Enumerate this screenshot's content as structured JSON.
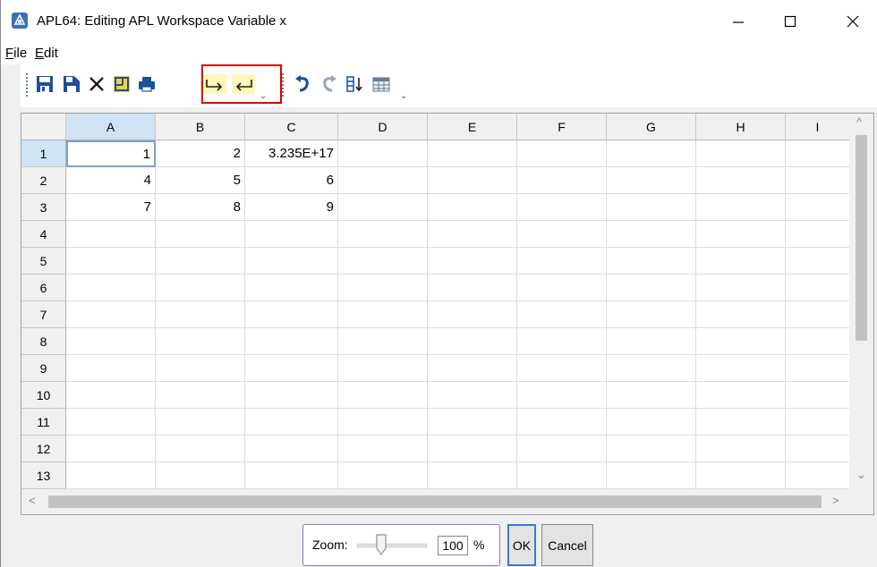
{
  "window": {
    "title": "APL64: Editing APL Workspace Variable x",
    "minimize_glyph": "—",
    "maximize_glyph": "☐",
    "close_glyph": "✕"
  },
  "menu": [
    {
      "label": "File",
      "accel": "F",
      "rest": "ile"
    },
    {
      "label": "Edit",
      "accel": "E",
      "rest": "dit"
    }
  ],
  "toolbar": {
    "icons": [
      "save-icon",
      "save-as-icon",
      "close-icon",
      "resize-icon",
      "print-icon",
      "redirect-right-icon",
      "redirect-left-icon",
      "undo-icon",
      "redo-icon",
      "sort-icon",
      "table-icon"
    ],
    "overflow_glyph": "⌄"
  },
  "grid": {
    "columns": [
      "A",
      "B",
      "C",
      "D",
      "E",
      "F",
      "G",
      "H",
      "I"
    ],
    "rows": [
      "1",
      "2",
      "3",
      "4",
      "5",
      "6",
      "7",
      "8",
      "9",
      "10",
      "11",
      "12",
      "13"
    ],
    "cells": [
      [
        "1",
        "2",
        "3.235E+17",
        "",
        "",
        "",
        "",
        "",
        ""
      ],
      [
        "4",
        "5",
        "6",
        "",
        "",
        "",
        "",
        "",
        ""
      ],
      [
        "7",
        "8",
        "9",
        "",
        "",
        "",
        "",
        "",
        ""
      ],
      [
        "",
        "",
        "",
        "",
        "",
        "",
        "",
        "",
        ""
      ],
      [
        "",
        "",
        "",
        "",
        "",
        "",
        "",
        "",
        ""
      ],
      [
        "",
        "",
        "",
        "",
        "",
        "",
        "",
        "",
        ""
      ],
      [
        "",
        "",
        "",
        "",
        "",
        "",
        "",
        "",
        ""
      ],
      [
        "",
        "",
        "",
        "",
        "",
        "",
        "",
        "",
        ""
      ],
      [
        "",
        "",
        "",
        "",
        "",
        "",
        "",
        "",
        ""
      ],
      [
        "",
        "",
        "",
        "",
        "",
        "",
        "",
        "",
        ""
      ],
      [
        "",
        "",
        "",
        "",
        "",
        "",
        "",
        "",
        ""
      ],
      [
        "",
        "",
        "",
        "",
        "",
        "",
        "",
        "",
        ""
      ],
      [
        "",
        "",
        "",
        "",
        "",
        "",
        "",
        "",
        ""
      ]
    ],
    "active_cell": "A1",
    "scroll_up": "^",
    "scroll_down": "⌄",
    "scroll_left": "<",
    "scroll_right": ">"
  },
  "footer": {
    "zoom_label": "Zoom:",
    "zoom_value": "100",
    "zoom_unit": "%",
    "ok_label": "OK",
    "cancel_label": "Cancel"
  },
  "colors": {
    "highlight_border": "#e00000",
    "selection": "#cfe3f5",
    "toolbar_blue": "#1a4f9c",
    "toolbar_yellow": "#f2d33a"
  }
}
